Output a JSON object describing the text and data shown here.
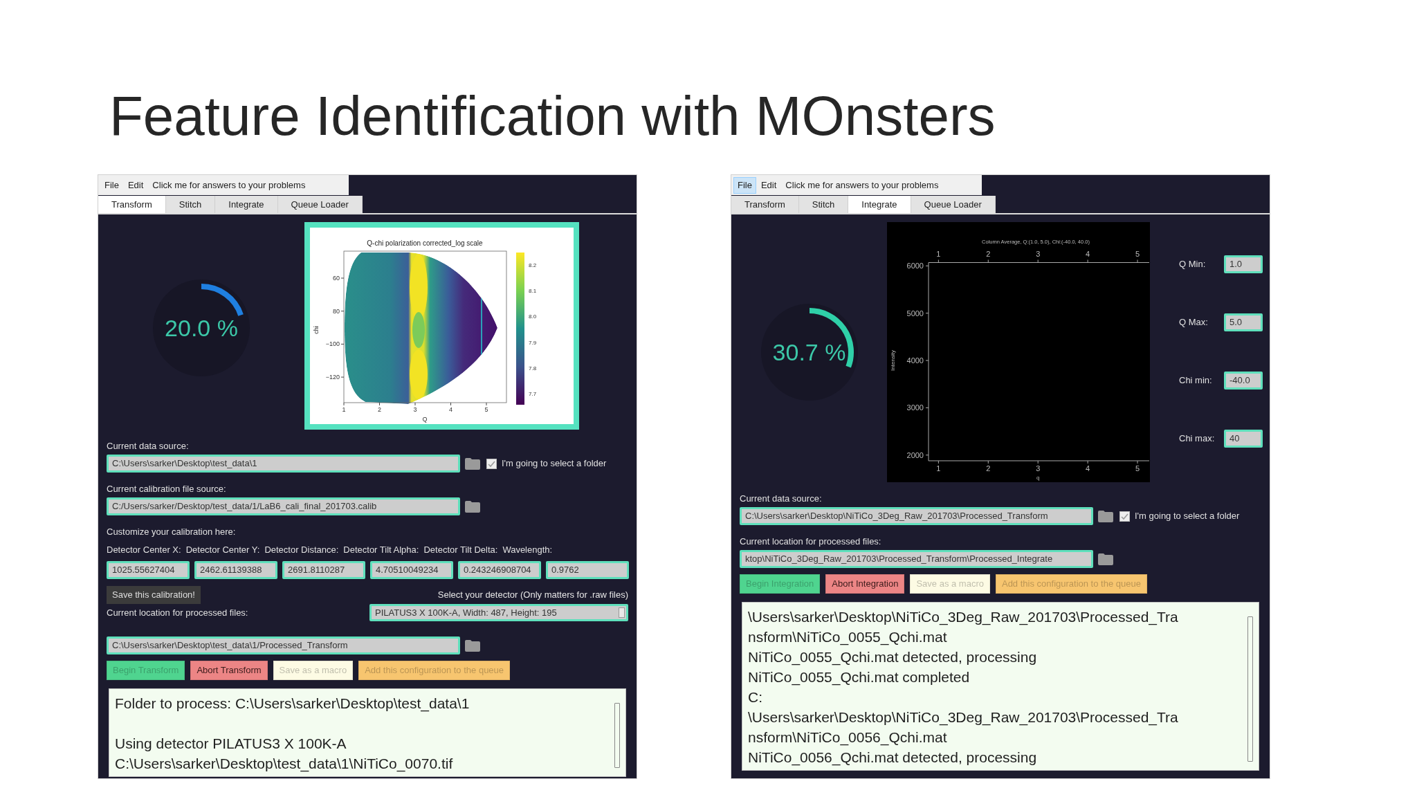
{
  "title": "Feature Identification with MOnsters",
  "panels": [
    {
      "menu": [
        {
          "label": "File",
          "selected": false
        },
        {
          "label": "Edit",
          "selected": false
        },
        {
          "label": "Click me for answers to your problems",
          "selected": false
        }
      ],
      "tabs": [
        {
          "label": "Transform",
          "selected": true
        },
        {
          "label": "Stitch",
          "selected": false
        },
        {
          "label": "Integrate",
          "selected": false
        },
        {
          "label": "Queue Loader",
          "selected": false
        }
      ],
      "progress": {
        "reading": "20.0 %",
        "color": "#1f7fe0"
      },
      "visual": {
        "kind": "heatmap",
        "title": "Q-chi polarization corrected_log scale",
        "xlabel": "Q",
        "ylabel": "chi",
        "xticks": [
          "1",
          "2",
          "3",
          "4",
          "5"
        ],
        "yticks": [
          "60",
          "80",
          "−100",
          "−120"
        ],
        "colorbar_ticks": [
          "8.2",
          "8.1",
          "8.0",
          "7.9",
          "7.8",
          "7.7"
        ]
      },
      "rows": [
        {
          "kind": "label",
          "text": "Current data source:"
        },
        {
          "kind": "path",
          "value": "C:\\Users\\sarker\\Desktop\\test_data\\1",
          "checkbox": {
            "checked": true,
            "label": "I'm going to select a folder"
          }
        },
        {
          "kind": "label",
          "text": "Current calibration file source:"
        },
        {
          "kind": "path",
          "value": "C:/Users/sarker/Desktop/test_data/1/LaB6_cali_final_201703.calib"
        },
        {
          "kind": "label",
          "text": "Customize your calibration here:"
        },
        {
          "kind": "label_row",
          "labels": [
            "Detector Center X:",
            "Detector Center Y:",
            "Detector Distance:",
            "Detector Tilt Alpha:",
            "Detector Tilt Delta:",
            "Wavelength:"
          ]
        },
        {
          "kind": "value_row",
          "values": [
            "1025.55627404",
            "2462.61139388",
            "2691.8110287",
            "4.70510049234",
            "0.243246908704",
            "0.9762"
          ]
        },
        {
          "kind": "calibration",
          "button": "Save this calibration!",
          "note": "Select your detector (Only matters for .raw files)"
        },
        {
          "kind": "label_dropdown",
          "text": "Current location for processed files:",
          "dropdown": "PILATUS3 X 100K-A, Width: 487, Height: 195"
        },
        {
          "kind": "path",
          "value": "C:\\Users\\sarker\\Desktop\\test_data\\1/Processed_Transform"
        },
        {
          "kind": "actions",
          "buttons": [
            {
              "label": "Begin Transform",
              "kind": "begin",
              "disabled": true
            },
            {
              "label": "Abort Transform",
              "kind": "abort",
              "disabled": false
            },
            {
              "label": "Save as a macro",
              "kind": "macro",
              "disabled": true
            },
            {
              "label": "Add this configuration to the queue",
              "kind": "queue",
              "disabled": true
            }
          ]
        }
      ],
      "log": {
        "lines": [
          {
            "text": "Folder to process: C:\\Users\\sarker\\Desktop\\test_data\\1",
            "spaced": false
          },
          {
            "text": "Using detector PILATUS3 X 100K-A",
            "spaced": true
          },
          {
            "text": "C:\\Users\\sarker\\Desktop\\test_data\\1\\NiTiCo_0070.tif",
            "spaced": false
          }
        ]
      }
    },
    {
      "menu": [
        {
          "label": "File",
          "selected": true
        },
        {
          "label": "Edit",
          "selected": false
        },
        {
          "label": "Click me for answers to your problems",
          "selected": false
        }
      ],
      "tabs": [
        {
          "label": "Transform",
          "selected": false
        },
        {
          "label": "Stitch",
          "selected": false
        },
        {
          "label": "Integrate",
          "selected": true
        },
        {
          "label": "Queue Loader",
          "selected": false
        }
      ],
      "progress": {
        "reading": "30.7 %",
        "color": "#2fd0a8"
      },
      "visual": {
        "kind": "chart",
        "top_ticks": [
          "1",
          "2",
          "3",
          "4",
          "5"
        ],
        "chart_data": {
          "type": "line",
          "title": "Column Average, Q:(1.0, 5.0), Chi:(-40.0, 40.0)",
          "xlabel": "q",
          "ylabel": "Intensity",
          "xlim": [
            0.8,
            5.25
          ],
          "ylim": [
            1880,
            6070
          ],
          "xticks": [
            1,
            2,
            3,
            4,
            5
          ],
          "yticks": [
            2000,
            3000,
            4000,
            5000,
            6000
          ]
        }
      },
      "settings": [
        {
          "label": "Q Min:",
          "value": "1.0"
        },
        {
          "label": "Q Max:",
          "value": "5.0"
        },
        {
          "label": "Chi min:",
          "value": "-40.0"
        },
        {
          "label": "Chi max:",
          "value": "40"
        }
      ],
      "rows": [
        {
          "kind": "label",
          "text": "Current data source:"
        },
        {
          "kind": "path",
          "value": "C:\\Users\\sarker\\Desktop\\NiTiCo_3Deg_Raw_201703\\Processed_Transform",
          "checkbox": {
            "checked": true,
            "label": "I'm going to select a folder"
          }
        },
        {
          "kind": "label",
          "text": "Current location for processed files:"
        },
        {
          "kind": "path",
          "value": "ktop\\NiTiCo_3Deg_Raw_201703\\Processed_Transform\\Processed_Integrate"
        },
        {
          "kind": "actions",
          "buttons": [
            {
              "label": "Begin Integration",
              "kind": "begin",
              "disabled": true
            },
            {
              "label": "Abort Integration",
              "kind": "abort",
              "disabled": false
            },
            {
              "label": "Save as a macro",
              "kind": "macro",
              "disabled": true
            },
            {
              "label": "Add this configuration to the queue",
              "kind": "queue",
              "disabled": true
            }
          ]
        }
      ],
      "log": {
        "lines": [
          {
            "text": "\\Users\\sarker\\Desktop\\NiTiCo_3Deg_Raw_201703\\Processed_Tra",
            "spaced": false
          },
          {
            "text": "nsform\\NiTiCo_0055_Qchi.mat",
            "spaced": false
          },
          {
            "text": "NiTiCo_0055_Qchi.mat detected, processing",
            "spaced": false
          },
          {
            "text": "NiTiCo_0055_Qchi.mat completed",
            "spaced": false
          },
          {
            "text": "C:",
            "spaced": false
          },
          {
            "text": "\\Users\\sarker\\Desktop\\NiTiCo_3Deg_Raw_201703\\Processed_Tra",
            "spaced": false
          },
          {
            "text": "nsform\\NiTiCo_0056_Qchi.mat",
            "spaced": false
          },
          {
            "text": "NiTiCo_0056_Qchi.mat detected, processing",
            "spaced": false
          }
        ]
      }
    }
  ]
}
